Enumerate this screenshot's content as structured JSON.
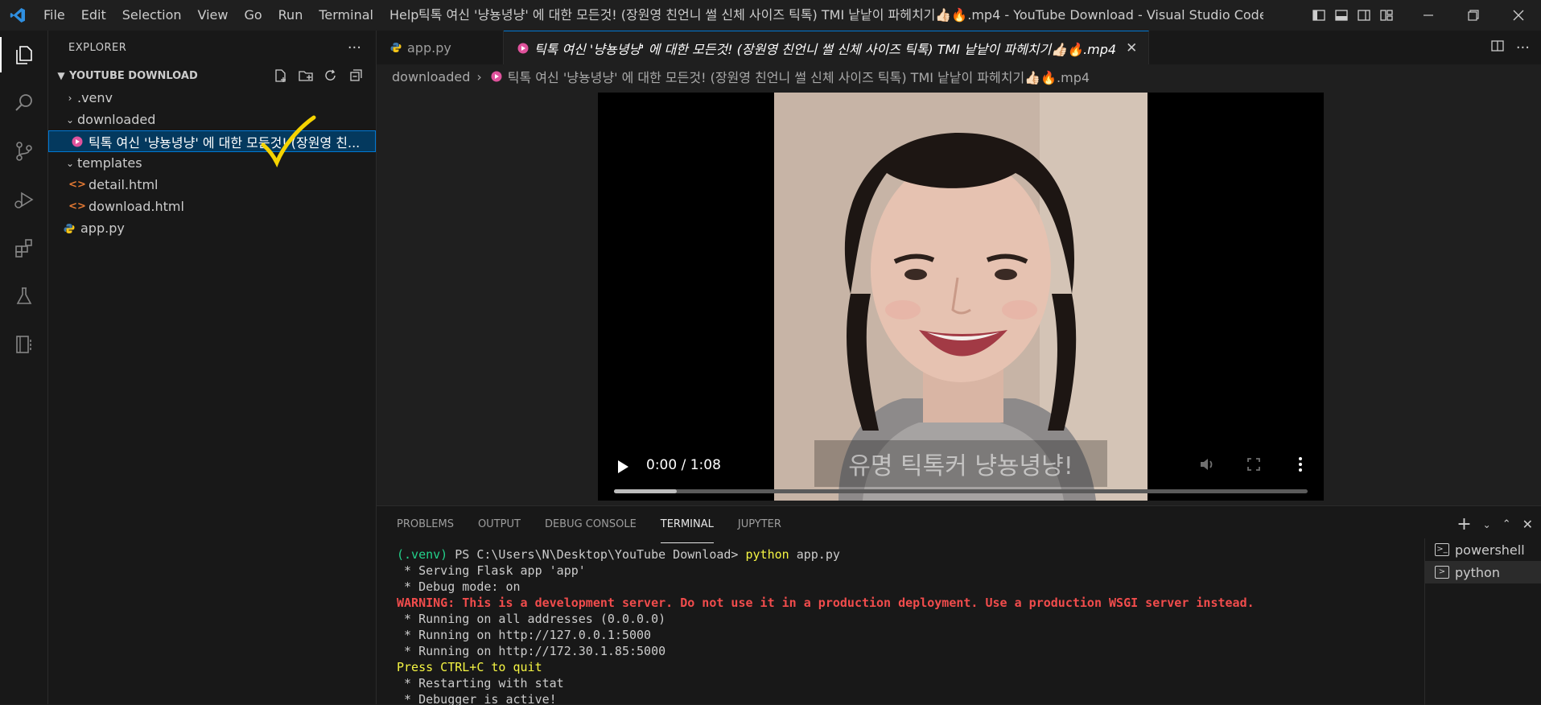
{
  "titlebar": {
    "menu": [
      "File",
      "Edit",
      "Selection",
      "View",
      "Go",
      "Run",
      "Terminal",
      "Help"
    ],
    "title": "틱톡 여신 '냥뇽녕냥' 에 대한 모든것! (장원영 친언니 썰 신체 사이즈 틱톡) TMI 낱낱이 파헤치기👍🏻🔥.mp4 - YouTube Download - Visual Studio Code"
  },
  "activitybar": {
    "items": [
      "explorer-icon",
      "search-icon",
      "source-control-icon",
      "run-debug-icon",
      "extensions-icon",
      "testing-icon",
      "jupyter-icon"
    ]
  },
  "sidebar": {
    "title": "EXPLORER",
    "more": "···",
    "folder_name": "YOUTUBE DOWNLOAD",
    "tree": [
      {
        "label": ".venv",
        "type": "folder",
        "expanded": false
      },
      {
        "label": "downloaded",
        "type": "folder",
        "expanded": true
      },
      {
        "label": "틱톡 여신 '냥뇽녕냥' 에 대한 모든것! (장원영 친...",
        "type": "video"
      },
      {
        "label": "templates",
        "type": "folder",
        "expanded": true
      },
      {
        "label": "detail.html",
        "type": "html"
      },
      {
        "label": "download.html",
        "type": "html"
      },
      {
        "label": "app.py",
        "type": "python"
      }
    ]
  },
  "tabs": [
    {
      "label": "app.py",
      "type": "python"
    },
    {
      "label": "틱톡 여신 '냥뇽녕냥' 에 대한 모든것! (장원영 친언니 썰 신체 사이즈 틱톡) TMI 낱낱이 파헤치기👍🏻🔥.mp4",
      "type": "video",
      "close": "✕"
    }
  ],
  "breadcrumb": {
    "folder": "downloaded",
    "file": "틱톡 여신 '냥뇽녕냥' 에 대한 모든것! (장원영 친언니 썰 신체 사이즈 틱톡) TMI 낱낱이 파헤치기👍🏻🔥.mp4"
  },
  "video": {
    "time": "0:00 / 1:08",
    "subtitle": "유명 틱톡커 냥뇽녕냥!",
    "progress": 0.09
  },
  "panel": {
    "tabs": [
      "PROBLEMS",
      "OUTPUT",
      "DEBUG CONSOLE",
      "TERMINAL",
      "JUPYTER"
    ],
    "active_tab": "TERMINAL",
    "terminal": {
      "prompt_env": "(.venv)",
      "prompt_path": " PS C:\\Users\\N\\Desktop\\YouTube Download> ",
      "command": "python",
      "command_arg": " app.py",
      "line1": " * Serving Flask app 'app'",
      "line2": " * Debug mode: on",
      "warning_label": "WARNING: This is a development server. Do not use it in a production deployment. Use a production WSGI server instead.",
      "line4": " * Running on all addresses (0.0.0.0)",
      "line5": " * Running on http://127.0.0.1:5000",
      "line6": " * Running on http://172.30.1.85:5000",
      "quit": "Press CTRL+C to quit",
      "line8": " * Restarting with stat",
      "line9": " * Debugger is active!"
    },
    "terminals": [
      "powershell",
      "python"
    ]
  },
  "colors": {
    "accent": "#0078d4",
    "video_icon": "#e0529c",
    "html_icon": "#e37933",
    "python_icon": "#3c78aa",
    "annotation": "#f5d300"
  }
}
